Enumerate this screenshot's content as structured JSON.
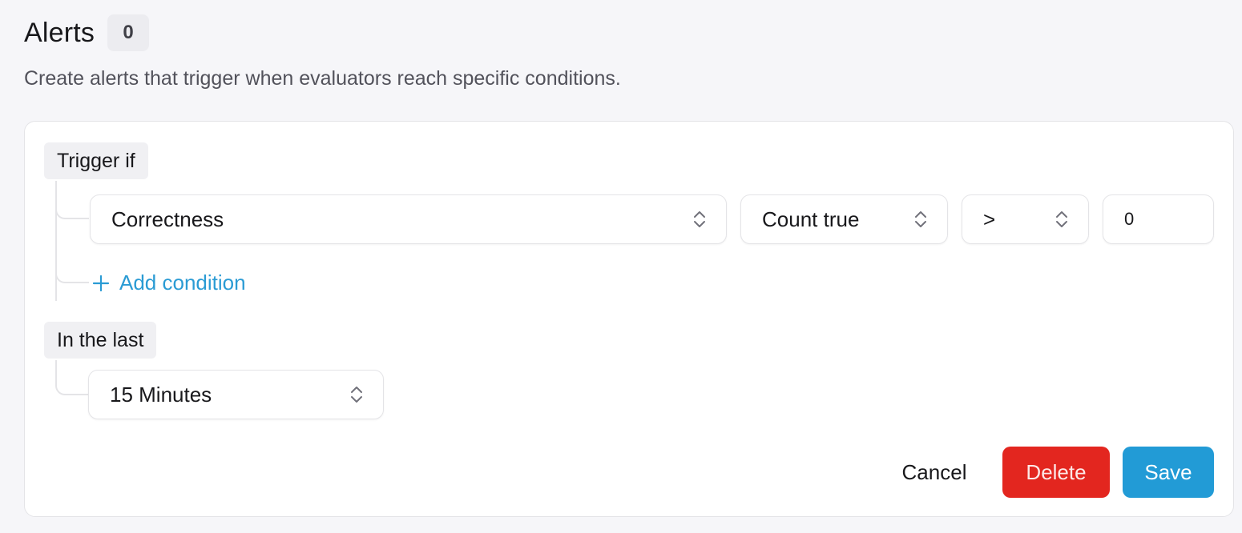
{
  "header": {
    "title": "Alerts",
    "count": "0"
  },
  "subtitle": "Create alerts that trigger when evaluators reach specific conditions.",
  "trigger": {
    "label": "Trigger if",
    "evaluator": "Correctness",
    "aggregation": "Count true",
    "operator": ">",
    "threshold": "0",
    "add_condition": "Add condition"
  },
  "window": {
    "label": "In the last",
    "duration": "15 Minutes"
  },
  "actions": {
    "cancel": "Cancel",
    "delete": "Delete",
    "save": "Save"
  },
  "colors": {
    "accent": "#229bd6",
    "danger": "#e3261f",
    "link": "#2a9bd4"
  }
}
